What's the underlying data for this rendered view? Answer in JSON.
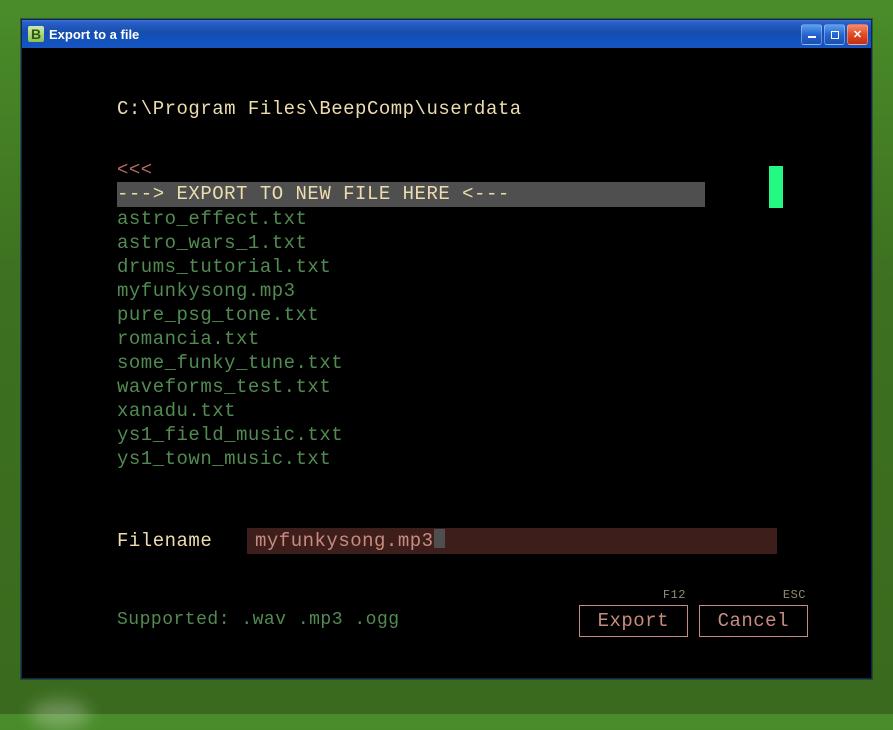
{
  "window": {
    "title": "Export to a file",
    "icon_letter": "B"
  },
  "path": "C:\\Program Files\\BeepComp\\userdata",
  "parent_dir_label": "<<<",
  "new_export_label": "---> EXPORT TO NEW FILE HERE <---",
  "files": [
    "astro_effect.txt",
    "astro_wars_1.txt",
    "drums_tutorial.txt",
    "myfunkysong.mp3",
    "pure_psg_tone.txt",
    "romancia.txt",
    "some_funky_tune.txt",
    "waveforms_test.txt",
    "xanadu.txt",
    "ys1_field_music.txt",
    "ys1_town_music.txt"
  ],
  "filename": {
    "label": "Filename",
    "value": "myfunkysong.mp3"
  },
  "supported_line": "Supported: .wav .mp3 .ogg",
  "buttons": {
    "export": {
      "label": "Export",
      "hint": "F12"
    },
    "cancel": {
      "label": "Cancel",
      "hint": "ESC"
    }
  }
}
